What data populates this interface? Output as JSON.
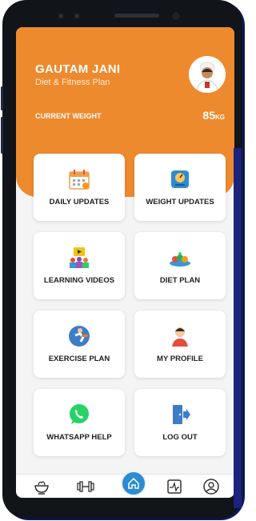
{
  "profile": {
    "name": "GAUTAM JANI",
    "plan": "Diet & Fitness Plan",
    "current_weight_label": "CURRENT WEIGHT",
    "current_weight_value": "85",
    "current_weight_unit": "KG"
  },
  "menu": {
    "items": [
      {
        "label": "DAILY UPDATES",
        "icon": "calendar-icon"
      },
      {
        "label": "WEIGHT UPDATES",
        "icon": "weighing-scale-icon"
      },
      {
        "label": "LEARNING VIDEOS",
        "icon": "video-lesson-icon"
      },
      {
        "label": "DIET PLAN",
        "icon": "food-plate-icon"
      },
      {
        "label": "EXERCISE PLAN",
        "icon": "exercise-icon"
      },
      {
        "label": "MY PROFILE",
        "icon": "person-icon"
      },
      {
        "label": "WHATSAPP HELP",
        "icon": "whatsapp-icon"
      },
      {
        "label": "LOG OUT",
        "icon": "logout-door-icon"
      }
    ]
  },
  "bottom_nav": [
    {
      "icon": "diet-bowl-icon",
      "active": false
    },
    {
      "icon": "dumbbell-icon",
      "active": false
    },
    {
      "icon": "home-icon",
      "active": true
    },
    {
      "icon": "workout-chart-icon",
      "active": false
    },
    {
      "icon": "profile-icon",
      "active": false
    }
  ],
  "colors": {
    "header": "#ee8a2e",
    "accent": "#2d8bd1",
    "whatsapp": "#25d366"
  }
}
